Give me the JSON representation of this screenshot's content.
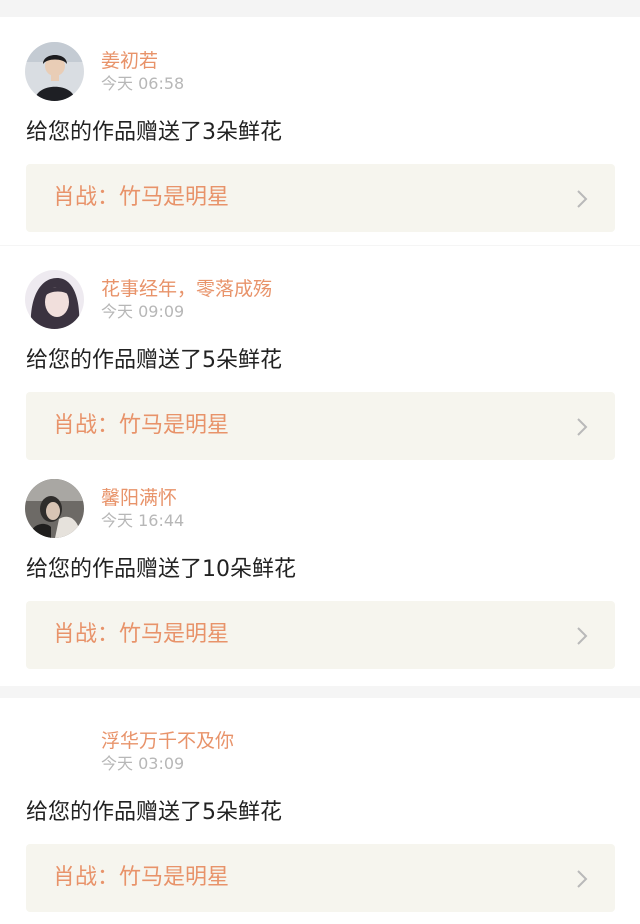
{
  "colors": {
    "accent": "#e8936a",
    "time_gray": "#b7b7b7",
    "text": "#222222",
    "work_bg": "#f6f5ee",
    "separator": "#f5f5f5"
  },
  "notifications": [
    {
      "name": "姜初若",
      "time": "今天 06:58",
      "message": "给您的作品赠送了3朵鲜花",
      "work_title": "肖战：竹马是明星",
      "chevron_icon": "chevron-right-icon"
    },
    {
      "name": "花事经年，零落成殇",
      "time": "今天 09:09",
      "message": "给您的作品赠送了5朵鲜花",
      "work_title": "肖战：竹马是明星",
      "chevron_icon": "chevron-right-icon"
    },
    {
      "name": "馨阳满怀",
      "time": "今天 16:44",
      "message": "给您的作品赠送了10朵鲜花",
      "work_title": "肖战：竹马是明星",
      "chevron_icon": "chevron-right-icon"
    },
    {
      "name": "浮华万千不及你",
      "time": "今天 03:09",
      "message": "给您的作品赠送了5朵鲜花",
      "work_title": "肖战：竹马是明星",
      "chevron_icon": "chevron-right-icon"
    }
  ]
}
